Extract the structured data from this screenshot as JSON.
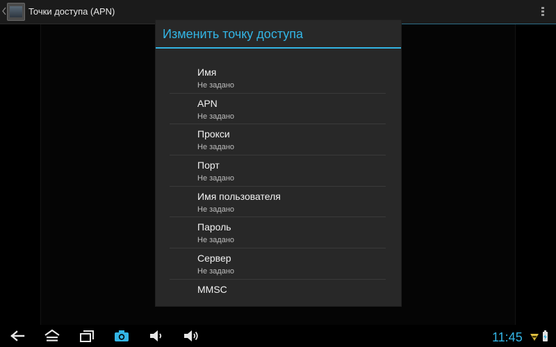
{
  "actionbar": {
    "title": "Точки доступа (APN)"
  },
  "dialog": {
    "title": "Изменить точку доступа",
    "items": [
      {
        "title": "Имя",
        "summary": "Не задано"
      },
      {
        "title": "APN",
        "summary": "Не задано"
      },
      {
        "title": "Прокси",
        "summary": "Не задано"
      },
      {
        "title": "Порт",
        "summary": "Не задано"
      },
      {
        "title": "Имя пользователя",
        "summary": "Не задано"
      },
      {
        "title": "Пароль",
        "summary": "Не задано"
      },
      {
        "title": "Сервер",
        "summary": "Не задано"
      },
      {
        "title": "MMSC",
        "summary": ""
      }
    ]
  },
  "statusbar": {
    "time": "11:45"
  },
  "icons": {
    "navigation": [
      "back-icon",
      "home-icon",
      "recent-apps-icon",
      "screenshot-icon",
      "volume-down-icon",
      "volume-up-icon"
    ],
    "status": [
      "wifi-icon",
      "battery-charging-icon"
    ]
  },
  "colors": {
    "accent": "#33b5e5",
    "dialog_bg": "#282828",
    "actionbar_bg": "#1b1b1b"
  }
}
